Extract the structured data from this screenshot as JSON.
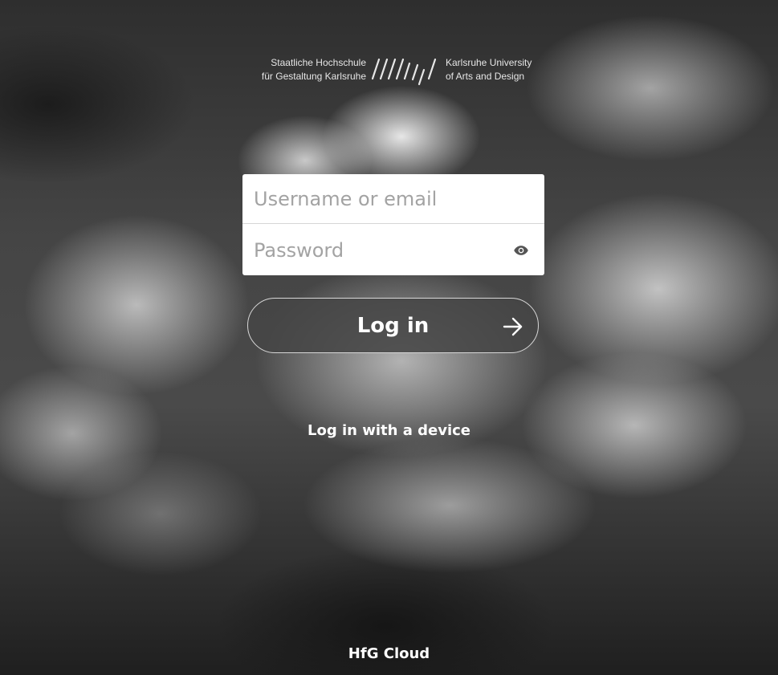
{
  "logo": {
    "line1_left": "Staatliche Hochschule",
    "line2_left": "für Gestaltung Karlsruhe",
    "line1_right": "Karlsruhe University",
    "line2_right": "of Arts and Design"
  },
  "form": {
    "username_placeholder": "Username or email",
    "username_value": "",
    "password_placeholder": "Password",
    "password_value": "",
    "toggle_password_icon": "eye-icon",
    "submit_label": "Log in",
    "submit_icon": "arrow-right-icon"
  },
  "alt_login": {
    "device_label": "Log in with a device"
  },
  "footer": {
    "label": "HfG Cloud"
  },
  "colors": {
    "button_bg": "#464646",
    "text_light": "#ffffff",
    "placeholder": "#a3a3a3"
  }
}
